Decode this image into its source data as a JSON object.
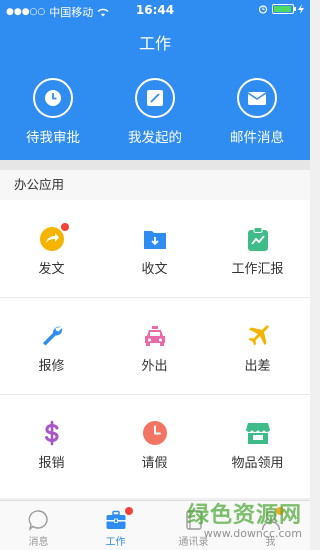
{
  "status": {
    "carrier": "中国移动",
    "time": "16:44",
    "signal_dots": "●●●○○"
  },
  "header": {
    "title": "工作",
    "buttons": [
      {
        "label": "待我审批",
        "icon": "clock-icon"
      },
      {
        "label": "我发起的",
        "icon": "edit-icon"
      },
      {
        "label": "邮件消息",
        "icon": "mail-icon"
      }
    ]
  },
  "section": {
    "title": "办公应用"
  },
  "apps": [
    {
      "label": "发文",
      "icon": "share-icon",
      "color": "#f5b400"
    },
    {
      "label": "收文",
      "icon": "inbox-folder-icon",
      "color": "#2f8cf0"
    },
    {
      "label": "工作汇报",
      "icon": "report-clipboard-icon",
      "color": "#3dbb88"
    },
    {
      "label": "报修",
      "icon": "wrench-icon",
      "color": "#2f8cf0"
    },
    {
      "label": "外出",
      "icon": "taxi-icon",
      "color": "#e86aa8"
    },
    {
      "label": "出差",
      "icon": "airplane-icon",
      "color": "#f5b400"
    },
    {
      "label": "报销",
      "icon": "dollar-icon",
      "color": "#a855c8"
    },
    {
      "label": "请假",
      "icon": "clock-icon",
      "color": "#f27463"
    },
    {
      "label": "物品领用",
      "icon": "store-icon",
      "color": "#3dbb88"
    }
  ],
  "tabbar": [
    {
      "label": "消息",
      "icon": "chat-bubble-icon"
    },
    {
      "label": "工作",
      "icon": "briefcase-icon"
    },
    {
      "label": "通讯录",
      "icon": "contacts-icon"
    },
    {
      "label": "我",
      "icon": "person-icon"
    }
  ],
  "watermark": {
    "line1": "绿色资源网",
    "line2": "www.downcc.com"
  }
}
